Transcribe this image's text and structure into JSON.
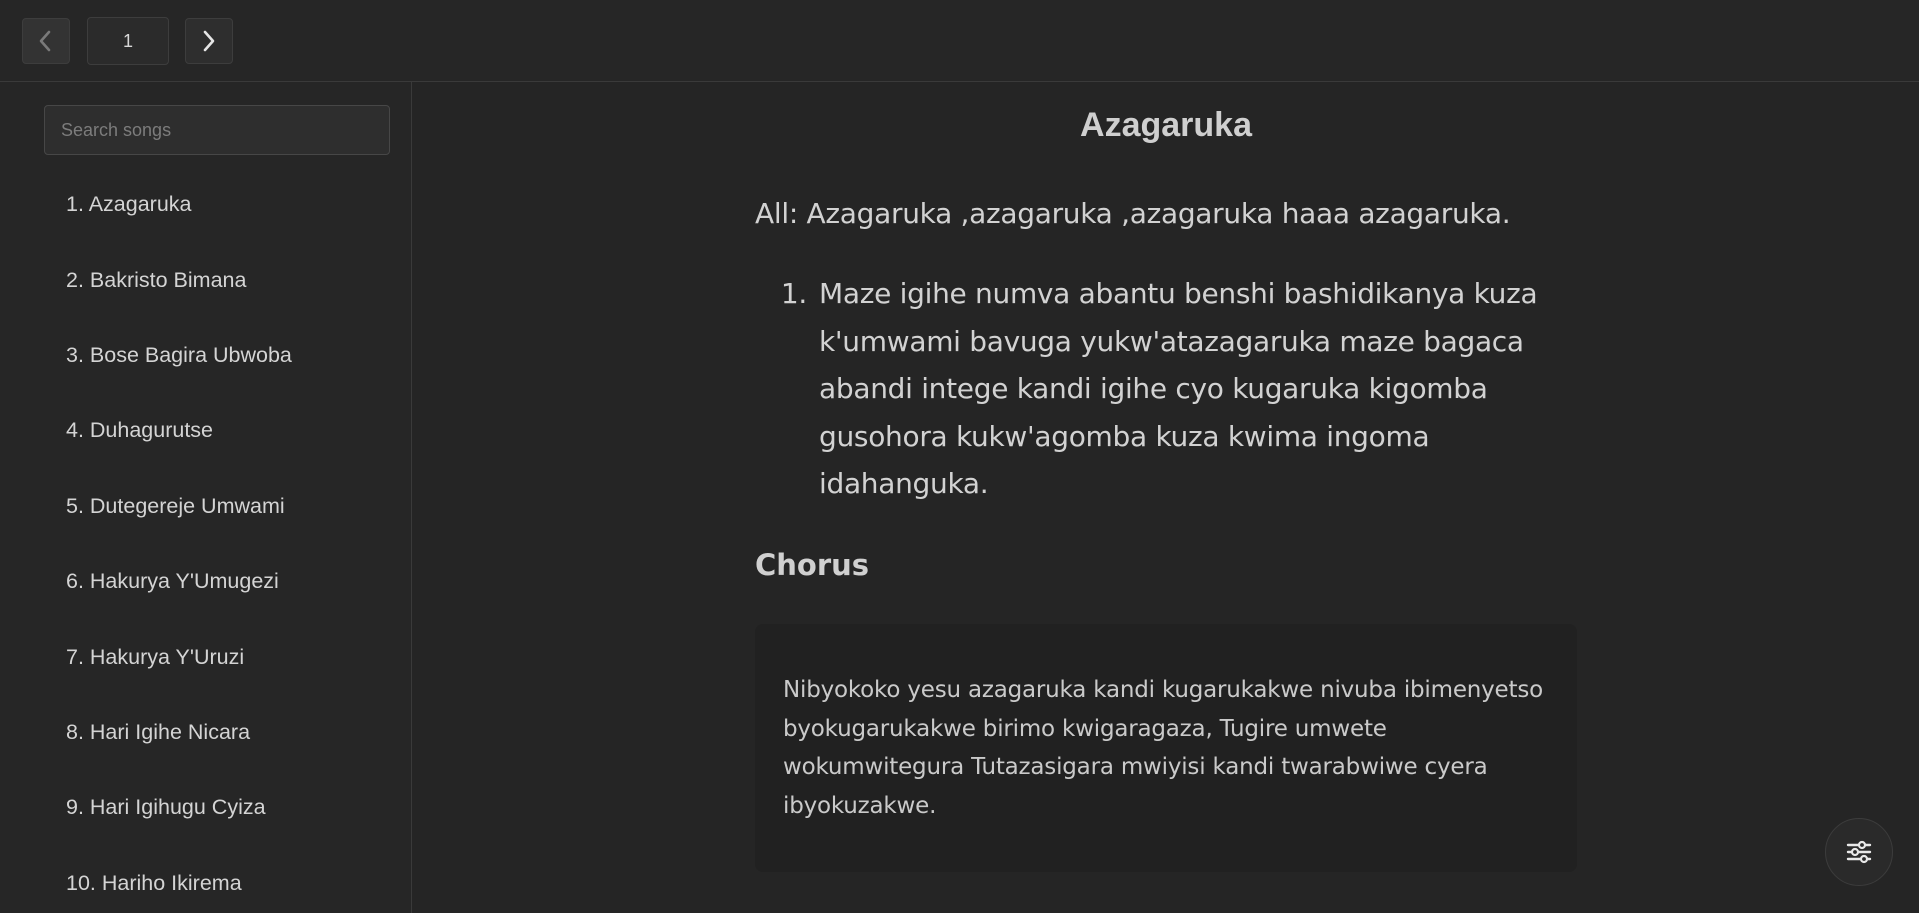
{
  "pager": {
    "prev_icon": "chevron-left-icon",
    "next_icon": "chevron-right-icon",
    "current_page": "1"
  },
  "sidebar": {
    "search_placeholder": "Search songs",
    "songs": [
      "1. Azagaruka",
      "2. Bakristo Bimana",
      "3. Bose Bagira Ubwoba",
      "4. Duhagurutse",
      "5. Dutegereje Umwami",
      "6. Hakurya Y'Umugezi",
      "7. Hakurya Y'Uruzi",
      "8. Hari Igihe Nicara",
      "9. Hari Igihugu Cyiza",
      "10. Hariho Ikirema"
    ]
  },
  "song": {
    "title": "Azagaruka",
    "all_line": "All: Azagaruka ,azagaruka ,azagaruka haaa azagaruka.",
    "verses": [
      {
        "number": "1.",
        "text": "Maze igihe numva abantu benshi bashidikanya kuza k'umwami bavuga yukw'atazagaruka maze bagaca abandi intege kandi igihe cyo kugaruka kigomba gusohora kukw'agomba kuza kwima ingoma idahanguka."
      }
    ],
    "chorus_heading": "Chorus",
    "chorus_text": "Nibyokoko yesu azagaruka kandi kugarukakwe nivuba ibimenyetso byokugarukakwe birimo kwigaragaza, Tugire umwete wokumwitegura Tutazasigara mwiyisi kandi twarabwiwe cyera ibyokuzakwe."
  },
  "settings": {
    "icon": "sliders-icon"
  },
  "colors": {
    "background": "#252525",
    "text": "#d6d6d6",
    "chorus_background": "#212121",
    "border": "#3a3a3a"
  }
}
